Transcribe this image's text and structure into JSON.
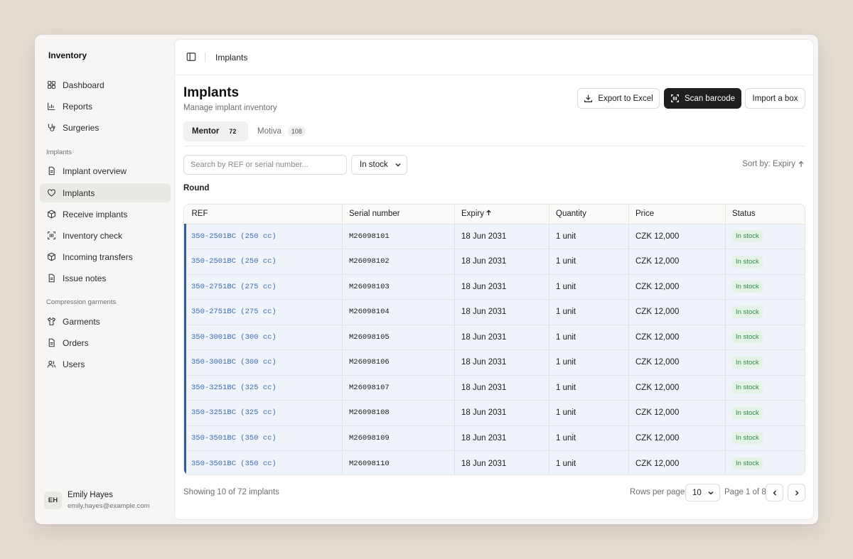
{
  "sidebar": {
    "app_title": "Inventory",
    "top_items": [
      {
        "label": "Dashboard",
        "icon": "grid-icon"
      },
      {
        "label": "Reports",
        "icon": "bar-chart-icon"
      },
      {
        "label": "Surgeries",
        "icon": "stethoscope-icon"
      }
    ],
    "section_implants": "Implants",
    "implant_items": [
      {
        "label": "Implant overview",
        "icon": "document-icon"
      },
      {
        "label": "Implants",
        "icon": "heart-icon",
        "active": true
      },
      {
        "label": "Receive implants",
        "icon": "box-icon"
      },
      {
        "label": "Inventory check",
        "icon": "scan-icon"
      },
      {
        "label": "Incoming transfers",
        "icon": "box-icon"
      },
      {
        "label": "Issue notes",
        "icon": "document-icon"
      }
    ],
    "section_garments": "Compression garments",
    "garment_items": [
      {
        "label": "Garments",
        "icon": "shirt-icon"
      },
      {
        "label": "Orders",
        "icon": "document-icon"
      },
      {
        "label": "Users",
        "icon": "users-icon"
      }
    ],
    "user": {
      "initials": "EH",
      "name": "Emily Hayes",
      "email": "emily.hayes@example.com"
    }
  },
  "topbar": {
    "breadcrumb": "Implants"
  },
  "header": {
    "title": "Implants",
    "subtitle": "Manage implant inventory",
    "export_label": "Export to Excel",
    "scan_label": "Scan barcode",
    "import_label": "Import a box"
  },
  "tabs": [
    {
      "label": "Mentor",
      "count": "72",
      "active": true
    },
    {
      "label": "Motiva",
      "count": "108",
      "active": false
    }
  ],
  "filters": {
    "search_placeholder": "Search by REF or serial number...",
    "status_value": "In stock",
    "sort_label": "Sort by: Expiry"
  },
  "group_label": "Round",
  "table": {
    "columns": [
      "REF",
      "Serial number",
      "Expiry",
      "Quantity",
      "Price",
      "Status"
    ],
    "rows": [
      {
        "ref": "350-2501BC (250 cc)",
        "serial": "M26098101",
        "expiry": "18 Jun 2031",
        "quantity": "1 unit",
        "price": "CZK 12,000",
        "status": "In stock"
      },
      {
        "ref": "350-2501BC (250 cc)",
        "serial": "M26098102",
        "expiry": "18 Jun 2031",
        "quantity": "1 unit",
        "price": "CZK 12,000",
        "status": "In stock"
      },
      {
        "ref": "350-2751BC (275 cc)",
        "serial": "M26098103",
        "expiry": "18 Jun 2031",
        "quantity": "1 unit",
        "price": "CZK 12,000",
        "status": "In stock"
      },
      {
        "ref": "350-2751BC (275 cc)",
        "serial": "M26098104",
        "expiry": "18 Jun 2031",
        "quantity": "1 unit",
        "price": "CZK 12,000",
        "status": "In stock"
      },
      {
        "ref": "350-3001BC (300 cc)",
        "serial": "M26098105",
        "expiry": "18 Jun 2031",
        "quantity": "1 unit",
        "price": "CZK 12,000",
        "status": "In stock"
      },
      {
        "ref": "350-3001BC (300 cc)",
        "serial": "M26098106",
        "expiry": "18 Jun 2031",
        "quantity": "1 unit",
        "price": "CZK 12,000",
        "status": "In stock"
      },
      {
        "ref": "350-3251BC (325 cc)",
        "serial": "M26098107",
        "expiry": "18 Jun 2031",
        "quantity": "1 unit",
        "price": "CZK 12,000",
        "status": "In stock"
      },
      {
        "ref": "350-3251BC (325 cc)",
        "serial": "M26098108",
        "expiry": "18 Jun 2031",
        "quantity": "1 unit",
        "price": "CZK 12,000",
        "status": "In stock"
      },
      {
        "ref": "350-3501BC (350 cc)",
        "serial": "M26098109",
        "expiry": "18 Jun 2031",
        "quantity": "1 unit",
        "price": "CZK 12,000",
        "status": "In stock"
      },
      {
        "ref": "350-3501BC (350 cc)",
        "serial": "M26098110",
        "expiry": "18 Jun 2031",
        "quantity": "1 unit",
        "price": "CZK 12,000",
        "status": "In stock"
      }
    ]
  },
  "footer": {
    "showing": "Showing 10 of 72 implants",
    "rows_per_page_label": "Rows per page",
    "rows_per_page_value": "10",
    "page_label": "Page 1 of 8"
  },
  "colors": {
    "accent": "#2f5f9e",
    "primary_button": "#1f1f21",
    "status_green": "#2f8a46",
    "row_tint": "#eff3fa"
  }
}
